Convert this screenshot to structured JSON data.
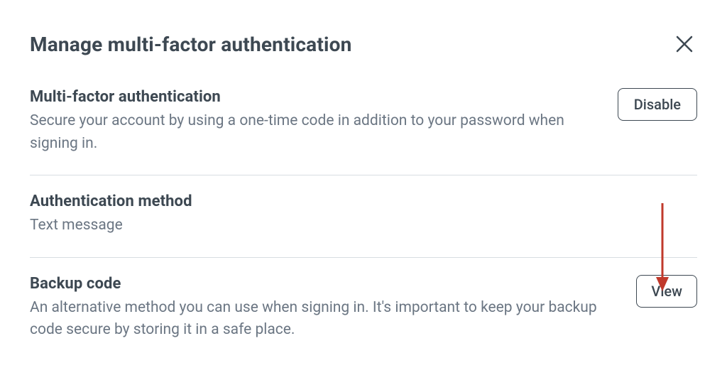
{
  "header": {
    "title": "Manage multi-factor authentication"
  },
  "mfa": {
    "title": "Multi-factor authentication",
    "description": "Secure your account by using a one-time code in addition to your password when signing in.",
    "button_label": "Disable"
  },
  "auth_method": {
    "title": "Authentication method",
    "value": "Text message"
  },
  "backup_code": {
    "title": "Backup code",
    "description": "An alternative method you can use when signing in. It's important to keep your backup code secure by storing it in a safe place.",
    "button_label": "View"
  },
  "annotation": {
    "arrow_color": "#c0392b"
  }
}
